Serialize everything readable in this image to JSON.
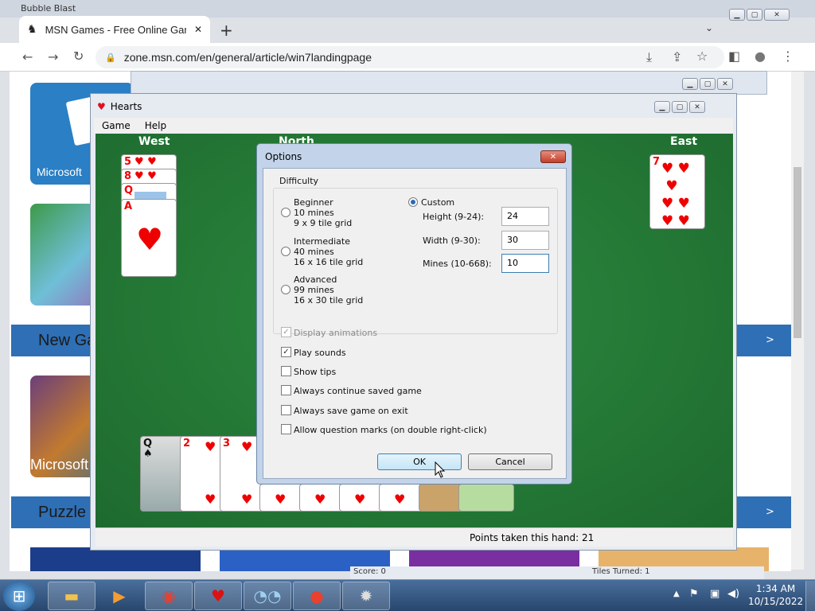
{
  "browser": {
    "background_window_title": "Bubble Blast",
    "tab_title": "MSN Games - Free Online Game",
    "tab_close": "✕",
    "new_tab": "+",
    "tab_list": "⌄",
    "url": "zone.msn.com/en/general/article/win7landingpage",
    "back_icon": "←",
    "forward_icon": "→",
    "reload_icon": "↻",
    "lock_icon": "🔒",
    "install_icon": "⤓",
    "share_icon": "⇪",
    "star_icon": "☆",
    "sidebar_icon": "◧",
    "profile_icon": "●",
    "menu_icon": "⋮",
    "win_min": "▁",
    "win_max": "▢",
    "win_close": "✕"
  },
  "page": {
    "tile1_label": "Microsoft",
    "section1": "New Ga",
    "section2": "Puzzle G",
    "tile3_label": "Microsoft",
    "bottom_left_status": "Score: 0",
    "bottom_right_status": "Tiles Turned: 1",
    "band_arrow": ">"
  },
  "hearts": {
    "title": "Hearts",
    "menu": [
      "Game",
      "Help"
    ],
    "players": {
      "west": "West",
      "north": "North",
      "east": "East"
    },
    "status": "Points taken this hand: 21",
    "west_cards": [
      "5",
      "8",
      "Q",
      "A"
    ],
    "east_card": "7",
    "hand": [
      "Q",
      "2",
      "3"
    ]
  },
  "dialog": {
    "title": "Options",
    "close": "✕",
    "difficulty_label": "Difficulty",
    "levels": [
      {
        "name": "Beginner",
        "mines": "10 mines",
        "grid": "9 x 9 tile grid",
        "selected": false
      },
      {
        "name": "Intermediate",
        "mines": "40 mines",
        "grid": "16 x 16 tile grid",
        "selected": false
      },
      {
        "name": "Advanced",
        "mines": "99 mines",
        "grid": "16 x 30 tile grid",
        "selected": false
      }
    ],
    "custom_label": "Custom",
    "custom_selected": true,
    "height_label": "Height (9-24):",
    "height_value": "24",
    "width_label": "Width (9-30):",
    "width_value": "30",
    "mines_label": "Mines (10-668):",
    "mines_value": "10",
    "checkboxes": [
      {
        "label": "Display animations",
        "checked": true,
        "disabled": true
      },
      {
        "label": "Play sounds",
        "checked": true,
        "disabled": false
      },
      {
        "label": "Show tips",
        "checked": false,
        "disabled": false
      },
      {
        "label": "Always continue saved game",
        "checked": false,
        "disabled": false
      },
      {
        "label": "Always save game on exit",
        "checked": false,
        "disabled": false
      },
      {
        "label": "Allow question marks (on double right-click)",
        "checked": false,
        "disabled": false
      }
    ],
    "ok": "OK",
    "cancel": "Cancel"
  },
  "taskbar": {
    "time": "1:34 AM",
    "date": "10/15/2022",
    "start_icon": "⊞",
    "apps": [
      "folder-icon",
      "media-player-icon",
      "chrome-icon",
      "hearts-icon",
      "eyes-icon",
      "game-icon",
      "minesweeper-icon"
    ]
  }
}
